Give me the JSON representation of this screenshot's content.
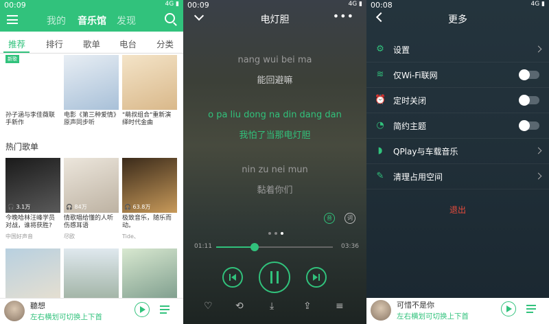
{
  "panel1": {
    "status_time": "00:09",
    "status_right": "4G ▮",
    "top_tabs": [
      "我的",
      "音乐馆",
      "发现"
    ],
    "sub_tabs": [
      "推荐",
      "排行",
      "歌单",
      "电台",
      "分类"
    ],
    "recommend": [
      {
        "badge": "新歌",
        "text": "孙子涵与李佳薇联手新作"
      },
      {
        "badge": "",
        "text": "电影《第三种爱情》原声同步听"
      },
      {
        "badge": "",
        "text": "\"萌叔组合\"重新演绎时代金曲"
      }
    ],
    "section_title": "热门歌单",
    "playlists": [
      {
        "count": "3.1万",
        "text": "今晚哈林汪峰学员对战，谁将获胜?",
        "sub": "中国好声音"
      },
      {
        "count": "84万",
        "text": "情歌唱给懂的人听伤感耳语",
        "sub": "尽欧"
      },
      {
        "count": "63.8万",
        "text": "极致音乐，随乐而动。",
        "sub": "Tide、"
      }
    ],
    "mini_player": {
      "title": "聽想",
      "subtitle": "左右横划可切换上下首"
    }
  },
  "panel2": {
    "status_time": "00:09",
    "status_right": "4G ▮",
    "song_title": "电灯胆",
    "more": "•••",
    "lyrics": [
      {
        "text": "nang wui bei ma",
        "style": "dim"
      },
      {
        "text": "能回避嘛",
        "style": "normal"
      },
      {
        "text": "o pa liu dong na din dang dan",
        "style": "hl"
      },
      {
        "text": "我怕了当那电灯胆",
        "style": "hl"
      },
      {
        "text": "nin zu nei mun",
        "style": "dim"
      },
      {
        "text": "黏着你们",
        "style": "dim"
      }
    ],
    "side_icons": [
      "音",
      "词"
    ],
    "time_elapsed": "01:11",
    "time_total": "03:36",
    "progress": 0.33
  },
  "panel3": {
    "status_time": "00:08",
    "status_right": "4G ▮",
    "title": "更多",
    "rows": [
      {
        "label": "设置",
        "type": "chev",
        "icon": "⚙"
      },
      {
        "label": "仅Wi-Fi联网",
        "type": "toggle",
        "icon": "≋"
      },
      {
        "label": "定时关闭",
        "type": "toggle",
        "icon": "⏰"
      },
      {
        "label": "简约主题",
        "type": "toggle",
        "icon": "◔"
      },
      {
        "label": "QPlay与车载音乐",
        "type": "chev",
        "icon": "◗"
      },
      {
        "label": "清理占用空间",
        "type": "chev",
        "icon": "✎"
      }
    ],
    "logout": "退出",
    "mini_player": {
      "title": "可惜不是你",
      "subtitle": "左右横划可切换上下首"
    }
  },
  "colors": {
    "accent": "#31c27c",
    "logout": "#e94b3c"
  }
}
